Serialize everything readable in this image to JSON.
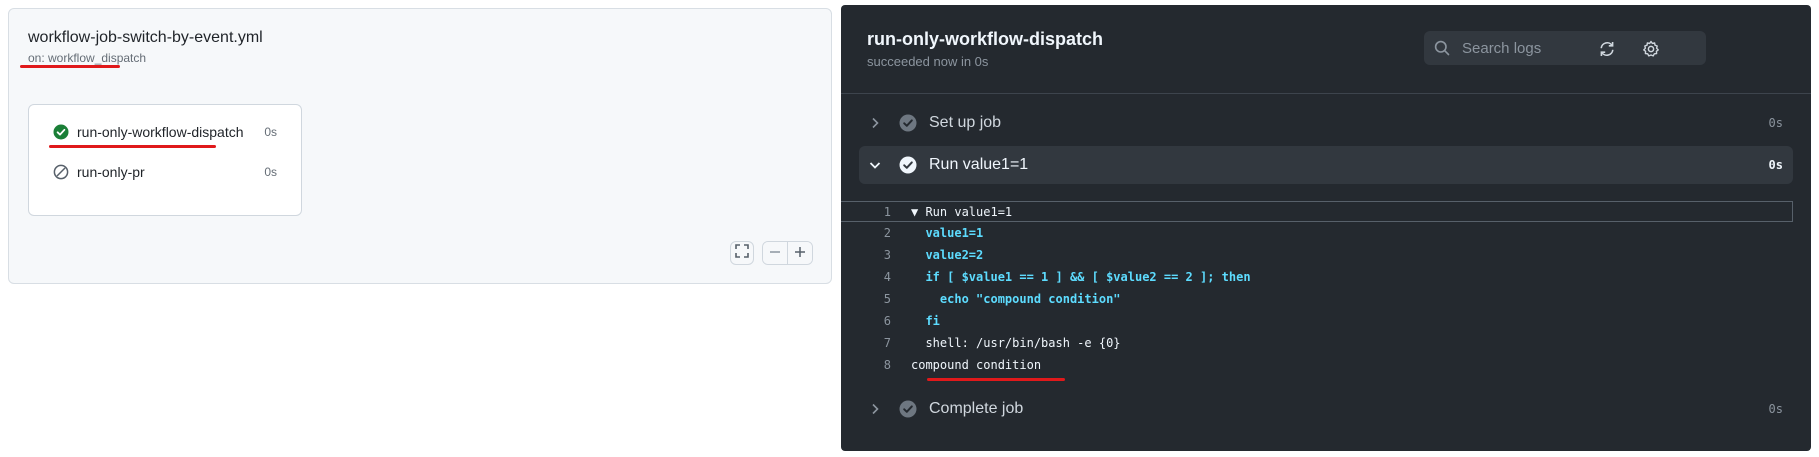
{
  "workflow": {
    "title": "workflow-job-switch-by-event.yml",
    "trigger": "on: workflow_dispatch",
    "jobs": [
      {
        "name": "run-only-workflow-dispatch",
        "duration": "0s",
        "status": "success"
      },
      {
        "name": "run-only-pr",
        "duration": "0s",
        "status": "skipped"
      }
    ]
  },
  "log_panel": {
    "title": "run-only-workflow-dispatch",
    "subtitle": "succeeded now in 0s",
    "search_placeholder": "Search logs",
    "steps": [
      {
        "label": "Set up job",
        "duration": "0s",
        "expanded": false
      },
      {
        "label": "Run value1=1",
        "duration": "0s",
        "expanded": true
      },
      {
        "label": "Complete job",
        "duration": "0s",
        "expanded": false
      }
    ],
    "log_lines": [
      {
        "num": "1",
        "text": "▼ Run value1=1"
      },
      {
        "num": "2",
        "text": "  value1=1"
      },
      {
        "num": "3",
        "text": "  value2=2"
      },
      {
        "num": "4",
        "text": "  if [ $value1 == 1 ] && [ $value2 == 2 ]; then"
      },
      {
        "num": "5",
        "text": "    echo \"compound condition\""
      },
      {
        "num": "6",
        "text": "  fi"
      },
      {
        "num": "7",
        "text": "  shell: /usr/bin/bash -e {0}"
      },
      {
        "num": "8",
        "text": "compound condition"
      }
    ]
  },
  "colors": {
    "success": "#1a7f37",
    "annotation_underline": "#e0191b",
    "log_command": "#5ddcff",
    "log_background": "#24292f"
  },
  "icons": {
    "job_success": "check-circle-fill-icon",
    "job_skipped": "skip-icon",
    "fullscreen": "screen-full-icon",
    "zoom_out": "dash-icon",
    "zoom_in": "plus-icon",
    "search": "search-icon",
    "refresh": "sync-icon",
    "settings": "gear-icon"
  }
}
